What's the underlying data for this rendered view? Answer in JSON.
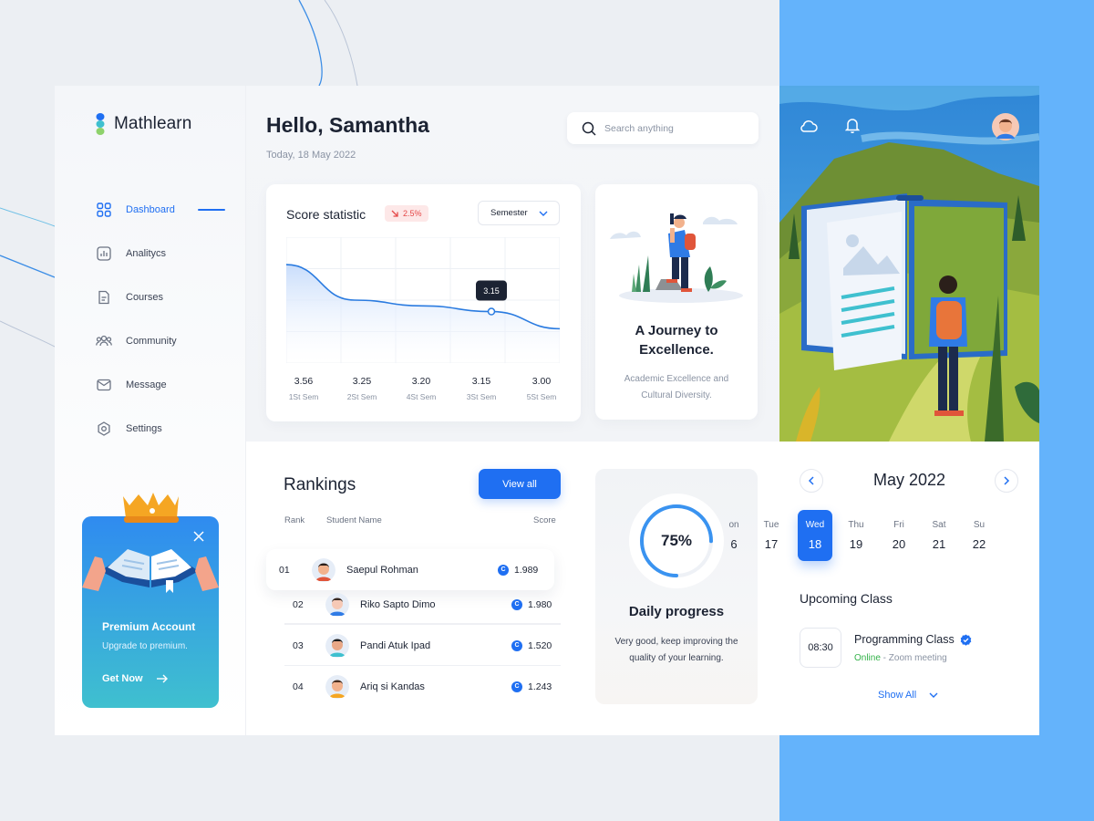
{
  "app": {
    "name": "Mathlearn"
  },
  "sidebar": {
    "items": [
      {
        "label": "Dashboard",
        "icon": "grid-icon",
        "active": true
      },
      {
        "label": "Analitycs",
        "icon": "bar-chart-icon",
        "active": false
      },
      {
        "label": "Courses",
        "icon": "document-icon",
        "active": false
      },
      {
        "label": "Community",
        "icon": "people-icon",
        "active": false
      },
      {
        "label": "Message",
        "icon": "mail-icon",
        "active": false
      },
      {
        "label": "Settings",
        "icon": "gear-icon",
        "active": false
      }
    ],
    "premium": {
      "title": "Premium Account",
      "subtitle": "Upgrade to premium.",
      "cta": "Get Now"
    }
  },
  "header": {
    "greeting": "Hello, Samantha",
    "date": "Today, 18 May 2022",
    "search_placeholder": "Search anything"
  },
  "score": {
    "title": "Score statistic",
    "badge": "2.5%",
    "filter": "Semester",
    "tooltip": "3.15"
  },
  "chart_data": {
    "type": "area",
    "title": "Score statistic",
    "categories": [
      "1St Sem",
      "2St Sem",
      "4St Sem",
      "3St Sem",
      "5St Sem"
    ],
    "values": [
      3.56,
      3.25,
      3.2,
      3.15,
      3.0
    ],
    "value_labels": [
      "3.56",
      "3.25",
      "3.20",
      "3.15",
      "3.00"
    ],
    "highlight_index": 3,
    "grid": true
  },
  "journey": {
    "title_line1": "A Journey to",
    "title_line2": "Excellence.",
    "subtitle": "Academic Excellence and Cultural Diversity."
  },
  "rankings": {
    "title": "Rankings",
    "view_all": "View all",
    "columns": {
      "rank": "Rank",
      "name": "Student Name",
      "score": "Score"
    },
    "coin_glyph": "C",
    "rows": [
      {
        "rank": "01",
        "name": "Saepul Rohman",
        "score": "1.989"
      },
      {
        "rank": "02",
        "name": "Riko Sapto Dimo",
        "score": "1.980"
      },
      {
        "rank": "03",
        "name": "Pandi Atuk Ipad",
        "score": "1.520"
      },
      {
        "rank": "04",
        "name": "Ariq si Kandas",
        "score": "1.243"
      }
    ]
  },
  "progress": {
    "percent_label": "75%",
    "value": 0.75,
    "title": "Daily progress",
    "subtitle": "Very good, keep improving the quality of your learning."
  },
  "calendar": {
    "month": "May 2022",
    "days": [
      {
        "name": "on",
        "date": "6"
      },
      {
        "name": "Tue",
        "date": "17"
      },
      {
        "name": "Wed",
        "date": "18",
        "selected": true
      },
      {
        "name": "Thu",
        "date": "19"
      },
      {
        "name": "Fri",
        "date": "20"
      },
      {
        "name": "Sat",
        "date": "21"
      },
      {
        "name": "Su",
        "date": "22"
      }
    ]
  },
  "upcoming": {
    "title": "Upcoming Class",
    "class": {
      "time": "08:30",
      "name": "Programming Class",
      "status": "Online",
      "meta": " - Zoom meeting"
    },
    "show_all": "Show All"
  },
  "colors": {
    "primary": "#1f6ff2",
    "danger": "#e54848",
    "online": "#33b249",
    "backdrop": "#64b3fb"
  }
}
